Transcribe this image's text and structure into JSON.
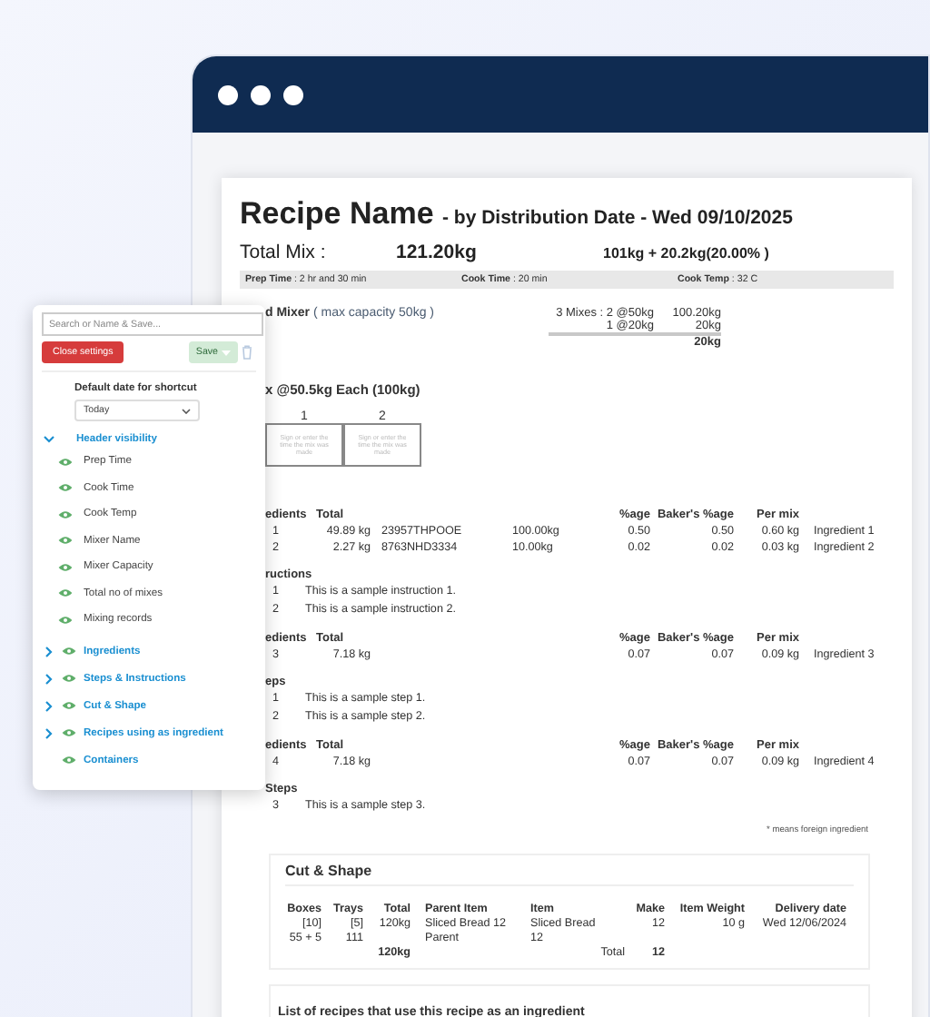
{
  "document": {
    "title": "Recipe Name",
    "subtitle": "- by Distribution Date - Wed 09/10/2025",
    "total_mix": {
      "label": "Total Mix :",
      "value": "121.20kg",
      "breakdown": "101kg + 20.2kg(20.00% )"
    },
    "info_bar": [
      {
        "label": "Prep Time",
        "value": ": 2 hr and 30 min"
      },
      {
        "label": "Cook Time",
        "value": ": 20 min"
      },
      {
        "label": "Cook Temp",
        "value": ": 32 C"
      }
    ],
    "mixer": {
      "name": "d Mixer",
      "capacity": "( max capacity 50kg )",
      "mixes": [
        {
          "label": "3 Mixes : 2 @50kg",
          "amount": "100.20kg"
        },
        {
          "label": "1 @20kg",
          "amount": "20kg"
        }
      ],
      "total": "20kg"
    },
    "mix_heading": "x @50.5kg Each (100kg)",
    "mix_boxes": [
      {
        "number": "1",
        "hint": "Sign or enter the time the mix was made"
      },
      {
        "number": "2",
        "hint": "Sign or enter the time the mix was made"
      }
    ],
    "blocks": [
      {
        "kind": "ingredients",
        "heading": "edients",
        "columns": [
          "Total",
          "%age",
          "Baker's %age",
          "Per mix"
        ],
        "rows": [
          {
            "number": "1",
            "total": "49.89 kg",
            "code": "23957THPOOE",
            "amount": "100.00kg",
            "percentage": "0.50",
            "bakers_percentage": "0.50",
            "per_mix": "0.60 kg",
            "name": "Ingredient 1"
          },
          {
            "number": "2",
            "total": "2.27 kg",
            "code": "8763NHD3334",
            "amount": "10.00kg",
            "percentage": "0.02",
            "bakers_percentage": "0.02",
            "per_mix": "0.03 kg",
            "name": "Ingredient 2"
          }
        ]
      },
      {
        "kind": "steps",
        "heading": "ructions",
        "rows": [
          {
            "number": "1",
            "text": "This is a sample instruction 1."
          },
          {
            "number": "2",
            "text": "This is a sample instruction 2."
          }
        ]
      },
      {
        "kind": "ingredients",
        "heading": "edients",
        "columns": [
          "Total",
          "%age",
          "Baker's %age",
          "Per mix"
        ],
        "rows": [
          {
            "number": "3",
            "total": "7.18 kg",
            "percentage": "0.07",
            "bakers_percentage": "0.07",
            "per_mix": "0.09 kg",
            "name": "Ingredient 3"
          }
        ]
      },
      {
        "kind": "steps",
        "heading": "eps",
        "rows": [
          {
            "number": "1",
            "text": "This is a sample step 1."
          },
          {
            "number": "2",
            "text": "This is a sample step 2."
          }
        ]
      },
      {
        "kind": "ingredients",
        "heading": "edients",
        "columns": [
          "Total",
          "%age",
          "Baker's %age",
          "Per mix"
        ],
        "rows": [
          {
            "number": "4",
            "total": "7.18 kg",
            "percentage": "0.07",
            "bakers_percentage": "0.07",
            "per_mix": "0.09 kg",
            "name": "Ingredient 4"
          }
        ]
      },
      {
        "kind": "steps",
        "heading": "Steps",
        "rows": [
          {
            "number": "3",
            "text": "This is a sample step 3."
          }
        ]
      }
    ],
    "footnote": "* means foreign ingredient",
    "cut_and_shape": {
      "title": "Cut & Shape",
      "columns": [
        "Boxes",
        "Trays",
        "Total",
        "Parent Item",
        "Item",
        "Make",
        "Item Weight",
        "Delivery date"
      ],
      "rows": [
        {
          "boxes": [
            "[10]",
            "55 + 5"
          ],
          "trays": [
            "[5]",
            "111"
          ],
          "total": "120kg",
          "parent_item": "Sliced Bread 12 Parent",
          "item": "Sliced Bread 12",
          "make": "12",
          "item_weight": "10 g",
          "delivery_date": "Wed 12/06/2024"
        }
      ],
      "totals": {
        "total": "120kg",
        "label": "Total",
        "make": "12"
      }
    },
    "list_card_title": "List of recipes that use this recipe as an ingredient"
  },
  "settings_panel": {
    "search": {
      "placeholder": "Search or Name & Save..."
    },
    "close_button": "Close settings",
    "save_button": {
      "label": "Save",
      "disabled": true
    },
    "default_date": {
      "label": "Default date for shortcut",
      "value": "Today"
    },
    "sections": [
      {
        "label": "Header visibility",
        "expanded": true,
        "children": [
          {
            "label": "Prep Time",
            "visible": true
          },
          {
            "label": "Cook Time",
            "visible": true
          },
          {
            "label": "Cook Temp",
            "visible": true
          },
          {
            "label": "Mixer Name",
            "visible": true
          },
          {
            "label": "Mixer Capacity",
            "visible": true
          },
          {
            "label": "Total no of mixes",
            "visible": true
          },
          {
            "label": "Mixing records",
            "visible": true
          }
        ]
      },
      {
        "label": "Ingredients",
        "expanded": false,
        "visible": true
      },
      {
        "label": "Steps & Instructions",
        "expanded": false,
        "visible": true
      },
      {
        "label": "Cut & Shape",
        "expanded": false,
        "visible": true
      },
      {
        "label": "Recipes using as ingredient",
        "expanded": false,
        "visible": true
      },
      {
        "label": "Containers",
        "visible": true
      }
    ]
  }
}
